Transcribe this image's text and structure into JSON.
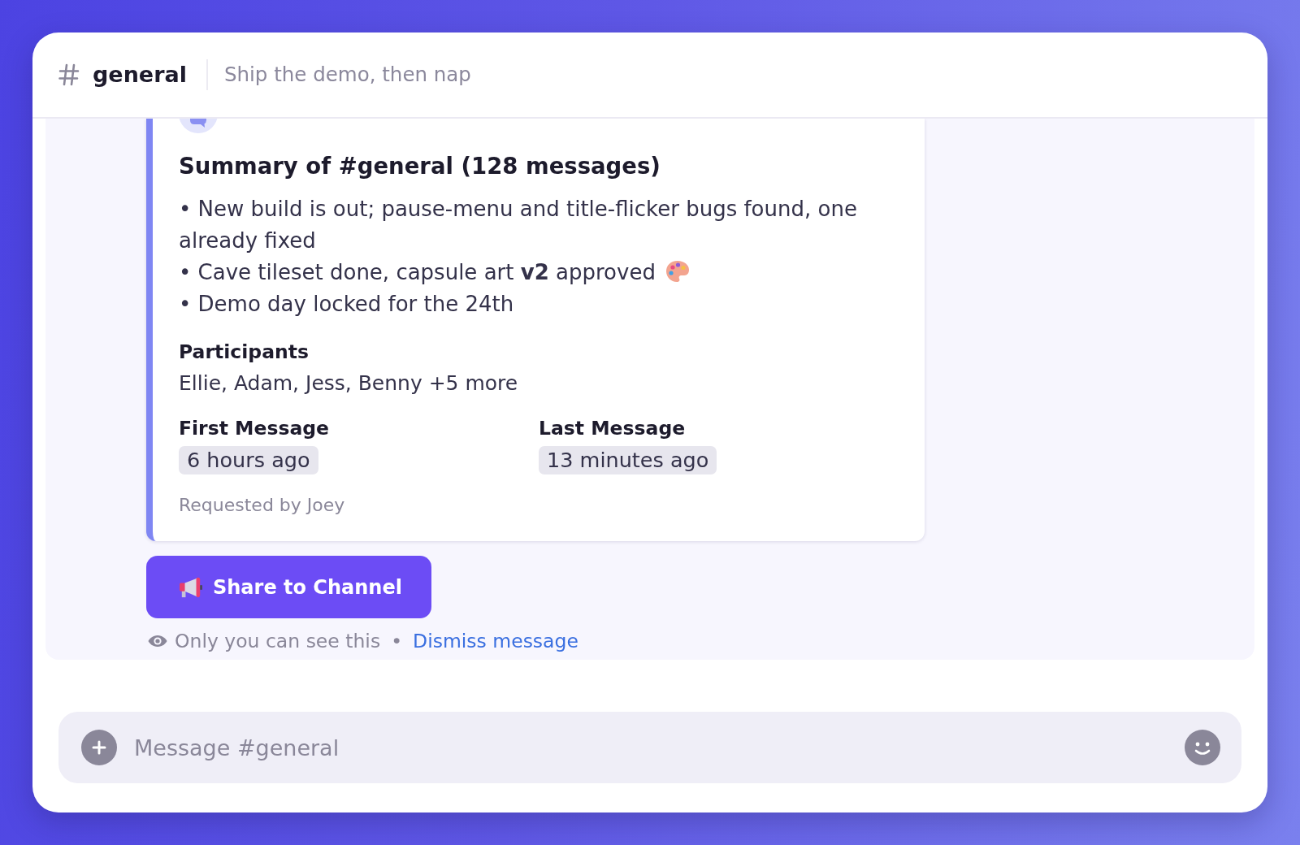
{
  "header": {
    "channel": "general",
    "topic": "Ship the demo, then nap"
  },
  "summary_card": {
    "title": "Summary of #general (128 messages)",
    "bullets": [
      {
        "kind": "plain",
        "text": "• New build is out; pause-menu and title-flicker bugs found, one already fixed"
      },
      {
        "kind": "emoji",
        "text": "• Cave tileset done, capsule art **v2** approved"
      },
      {
        "kind": "plain",
        "text": "• Demo day locked for the 24th"
      }
    ],
    "participants": {
      "label": "Participants",
      "value": "Ellie, Adam, Jess, Benny +5 more"
    },
    "stats": [
      {
        "label": "First Message",
        "value": "6 hours ago"
      },
      {
        "label": "Last Message",
        "value": "13 minutes ago"
      }
    ],
    "requested_by": "Requested by Joey"
  },
  "share_button": {
    "label": "Share to Channel"
  },
  "visibility_note": {
    "text": "Only you can see this",
    "separator": "•",
    "link": "Dismiss message"
  },
  "composer": {
    "placeholder": "Message #general"
  }
}
